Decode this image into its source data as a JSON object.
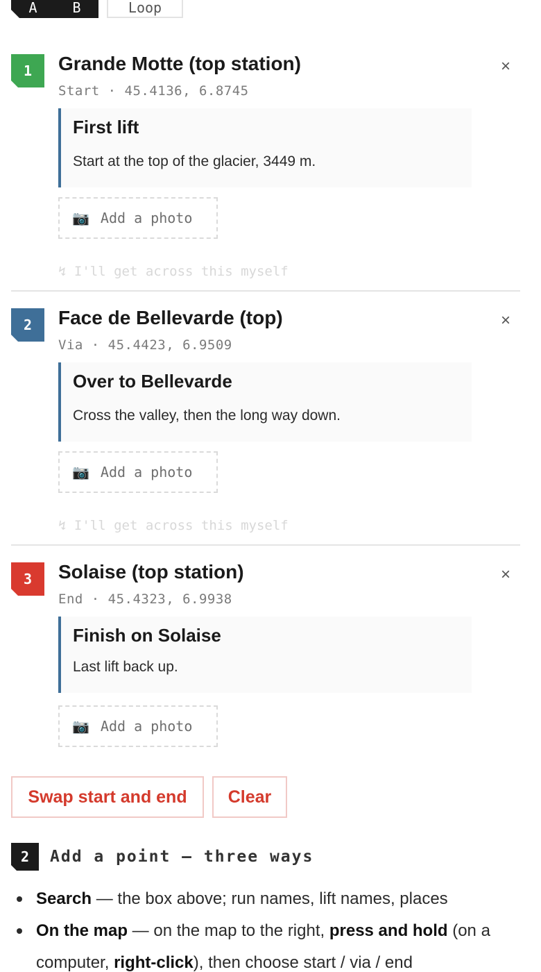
{
  "modes": {
    "ab_letters": [
      "A",
      "B"
    ],
    "loop_label": "Loop"
  },
  "stops": [
    {
      "number": "1",
      "color": "#3ea752",
      "name": "Grande Motte (top station)",
      "role": "Start",
      "coords": "45.4136, 6.8745",
      "note_title": "First lift",
      "note_text": "Start at the top of the glacier, 3449 m.",
      "photo_label": "Add a photo",
      "cross_label": "↯ I'll get across this myself"
    },
    {
      "number": "2",
      "color": "#3f6f98",
      "name": "Face de Bellevarde (top)",
      "role": "Via",
      "coords": "45.4423, 6.9509",
      "note_title": "Over to Bellevarde",
      "note_text": "Cross the valley, then the long way down.",
      "photo_label": "Add a photo",
      "cross_label": "↯ I'll get across this myself"
    },
    {
      "number": "3",
      "color": "#d93a2f",
      "name": "Solaise (top station)",
      "role": "End",
      "coords": "45.4323, 6.9938",
      "note_title": "Finish on Solaise",
      "note_text": "Last lift back up.",
      "photo_label": "Add a photo"
    }
  ],
  "separator": " · ",
  "close_glyph": "×",
  "camera_glyph": "📷",
  "actions": {
    "swap_label": "Swap start and end",
    "clear_label": "Clear"
  },
  "section2": {
    "number": "2",
    "title": "Add a point — three ways",
    "ways": [
      {
        "bold": "Search",
        "rest": " — the box above; run names, lift names, places"
      },
      {
        "bold": "On the map",
        "mid": " — on the map to the right, ",
        "bold2": "press and hold",
        "mid2": " (on a computer, ",
        "bold3": "right-click",
        "rest": "), then choose start / via / end"
      }
    ]
  }
}
